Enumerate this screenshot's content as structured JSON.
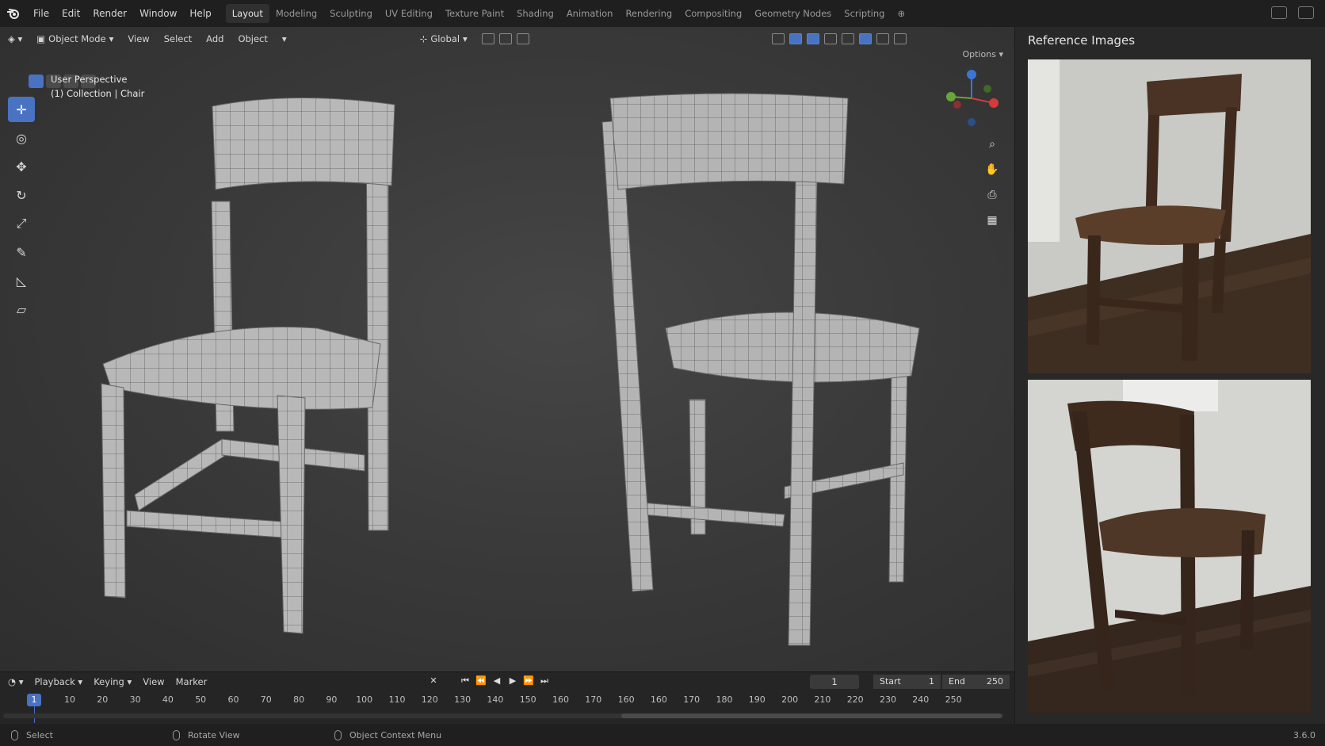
{
  "menu": [
    "File",
    "Edit",
    "Render",
    "Window",
    "Help"
  ],
  "workspaces": [
    "Layout",
    "Modeling",
    "Sculpting",
    "UV Editing",
    "Texture Paint",
    "Shading",
    "Animation",
    "Rendering",
    "Compositing",
    "Geometry Nodes",
    "Scripting"
  ],
  "active_workspace": "Layout",
  "viewport_header": {
    "mode": "Object Mode",
    "view": "View",
    "select": "Select",
    "add": "Add",
    "object": "Object",
    "transform_orientation": "Global",
    "options": "Options"
  },
  "viewport": {
    "perspective": "User Perspective",
    "collection": "(1) Collection | Chair"
  },
  "tools": [
    "cursor-tool",
    "select-tool",
    "move-tool",
    "rotate-tool",
    "scale-tool",
    "annotate-tool",
    "measure-tool",
    "add-cube-tool"
  ],
  "gizmo": {
    "x_color": "#d63a3a",
    "y_color": "#6aa53a",
    "z_color": "#3a76d6"
  },
  "sidebar": {
    "title": "Reference Images"
  },
  "timeline": {
    "playback": "Playback",
    "keying": "Keying",
    "view": "View",
    "marker": "Marker",
    "current_frame": "1",
    "start_label": "Start",
    "start_value": "1",
    "end_label": "End",
    "end_value": "250",
    "ruler": [
      "1",
      "10",
      "20",
      "30",
      "40",
      "50",
      "60",
      "70",
      "80",
      "90",
      "100",
      "110",
      "120",
      "130",
      "140",
      "150",
      "160",
      "170",
      "160",
      "160",
      "170",
      "180",
      "190",
      "200",
      "210",
      "220",
      "230",
      "240",
      "250"
    ]
  },
  "status": {
    "select": "Select",
    "rotate": "Rotate View",
    "context": "Object Context Menu",
    "version": "3.6.0"
  },
  "colors": {
    "accent": "#4a72c2",
    "mesh": "#b9b9b9",
    "wood": "#4a3324"
  }
}
